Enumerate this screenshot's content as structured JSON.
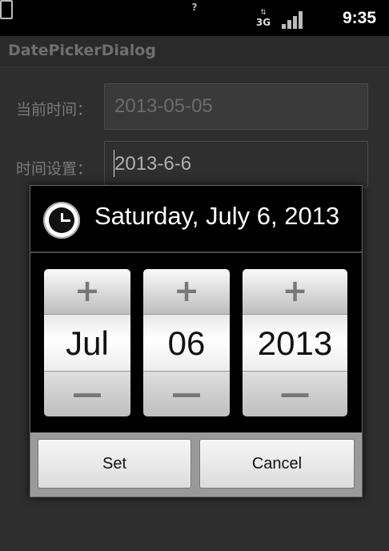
{
  "status_bar": {
    "network_label": "3G",
    "network_arrows": "⇅",
    "battery_label": "?",
    "time": "9:35",
    "icons": [
      "network-3g-icon",
      "signal-icon",
      "battery-icon"
    ]
  },
  "app": {
    "title": "DatePickerDialog"
  },
  "form": {
    "current_time_label": "当前时间：",
    "current_time_value": "2013-05-05",
    "set_time_label": "时间设置：",
    "set_time_value": "2013-6-6"
  },
  "dialog": {
    "icon": "clock-icon",
    "title": "Saturday, July 6, 2013",
    "month": {
      "plus": "+",
      "value": "Jul",
      "minus": "—"
    },
    "day": {
      "plus": "+",
      "value": "06",
      "minus": "—"
    },
    "year": {
      "plus": "+",
      "value": "2013",
      "minus": "—"
    },
    "set_label": "Set",
    "cancel_label": "Cancel"
  }
}
